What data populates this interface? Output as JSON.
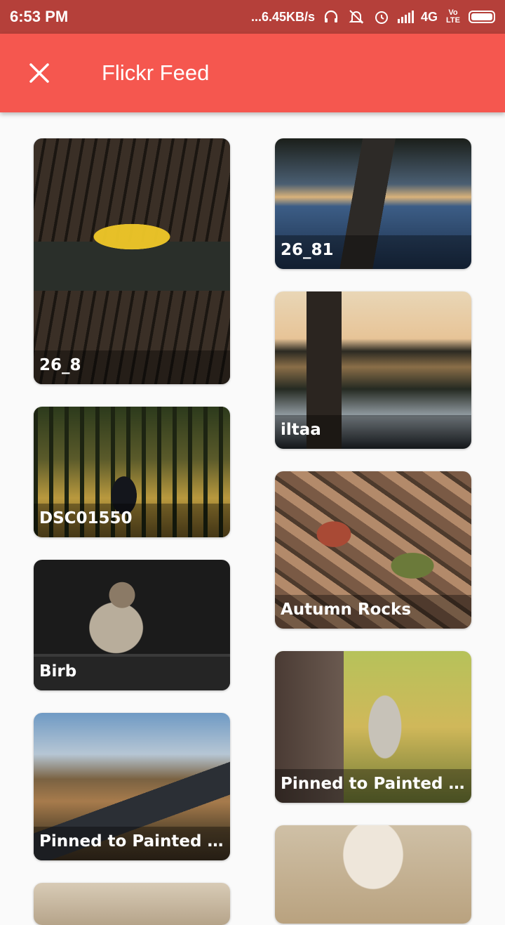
{
  "status_bar": {
    "time": "6:53 PM",
    "net_speed": "...6.45KB/s",
    "network_type": "4G",
    "volte": "Vo LTE",
    "icons": [
      "headphones-icon",
      "mute-icon",
      "alarm-icon",
      "signal-icon",
      "battery-icon"
    ]
  },
  "app_bar": {
    "title": "Flickr Feed",
    "close_icon": "close-icon"
  },
  "colors": {
    "status_bar_bg": "#b5403a",
    "app_bar_bg": "#f5574f",
    "page_bg": "#fafafa"
  },
  "feed": {
    "left_column": [
      {
        "title": "26_8"
      },
      {
        "title": "DSC01550"
      },
      {
        "title": "Birb"
      },
      {
        "title": "Pinned to Painted by..."
      },
      {
        "title": ""
      }
    ],
    "right_column": [
      {
        "title": "26_81"
      },
      {
        "title": "iltaa"
      },
      {
        "title": "Autumn Rocks"
      },
      {
        "title": "Pinned to Painted by..."
      },
      {
        "title": ""
      }
    ]
  }
}
